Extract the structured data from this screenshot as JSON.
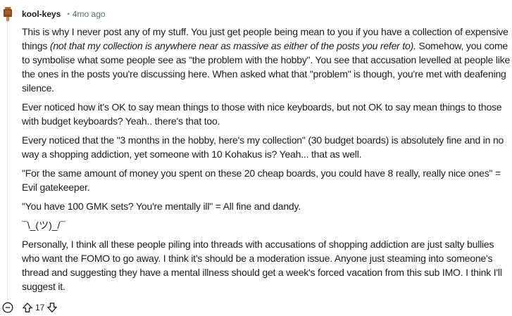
{
  "comment": {
    "author": "kool-keys",
    "separator": "•",
    "time": "4mo ago",
    "avatar_icon": "keycap-avatar-icon",
    "paragraphs": {
      "p1_a": "This is why I never post any of my stuff. You just get people being mean to you if you have a collection of expensive things ",
      "p1_em": "(not that my collection is anywhere near as massive as either of the posts you refer to).",
      "p1_b": " Somehow, you come to symbolise what some people see as \"the problem with the hobby\". You see that accusation levelled at people like the ones in the posts you're discussing here. When asked what that \"problem\" is though, you're met with deafening silence.",
      "p2": "Ever noticed how it's OK to say mean things to those with nice keyboards, but not OK to say mean things to those with budget keyboards? Yeah.. there's that too.",
      "p3": "Every noticed that the \"3 months in the hobby, here's my collection\" (30 budget boards) is absolutely fine and in no way a shopping addiction, yet someone with 10 Kohakus is? Yeah... that as well.",
      "p4": "\"For the same amount of money you spent on these 20 cheap boards, you could have 8 really, really nice ones\" = Evil gatekeeper.",
      "p5": "\"You have 100 GMK sets? You're mentally ill\" = All fine and dandy.",
      "p6": "¯\\_(ツ)_/¯",
      "p7": "Personally, I think all these people piling into threads with accusations of shopping addiction are just salty bullies who want the FOMO to go away. I think it's should be a moderation issue. Anyone just steaming into someone's thread and suggesting they have a mental illness should get a week's forced vacation from this sub IMO. I think I'll suggest it."
    },
    "score": "17",
    "icons": {
      "collapse": "collapse-minus-icon",
      "upvote": "upvote-arrow-icon",
      "downvote": "downvote-arrow-icon"
    },
    "colors": {
      "avatar_cap": "#8a4b1c",
      "avatar_stem": "#d08a3a",
      "meta_text": "#576f76",
      "thread_line": "#e5ebee"
    }
  }
}
